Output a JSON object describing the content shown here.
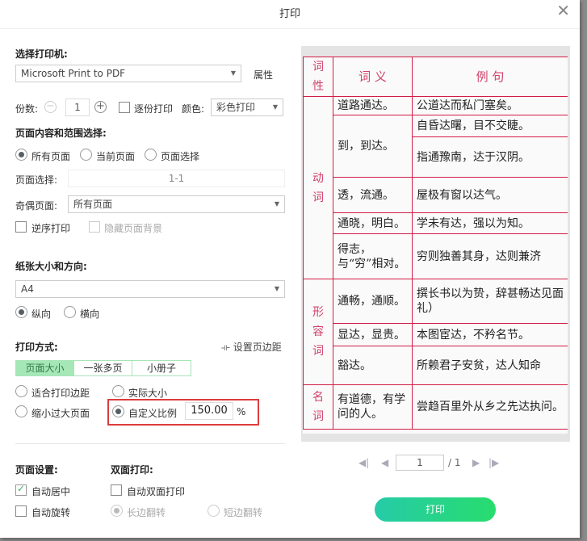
{
  "title": "打印",
  "printer": {
    "label": "选择打印机:",
    "value": "Microsoft Print to PDF",
    "properties": "属性"
  },
  "copies": {
    "label": "份数:",
    "value": "1",
    "collate": "逐份打印",
    "color_label": "颜色:",
    "color_value": "彩色打印"
  },
  "range": {
    "label": "页面内容和范围选择:",
    "all": "所有页面",
    "current": "当前页面",
    "select": "页面选择",
    "select_label": "页面选择:",
    "select_value": "1-1",
    "oddeven_label": "奇偶页面:",
    "oddeven_value": "所有页面",
    "reverse": "逆序打印",
    "hide_bg": "隐藏页面背景"
  },
  "paper": {
    "label": "纸张大小和方向:",
    "size": "A4",
    "portrait": "纵向",
    "landscape": "横向"
  },
  "mode": {
    "label": "打印方式:",
    "margins": "设置页边距",
    "tabs": [
      "页面大小",
      "一张多页",
      "小册子"
    ],
    "fit": "适合打印边距",
    "actual": "实际大小",
    "shrink": "缩小过大页面",
    "custom": "自定义比例",
    "scale": "150.00",
    "percent": "%"
  },
  "page_setup": {
    "label": "页面设置:",
    "center": "自动居中",
    "rotate": "自动旋转"
  },
  "duplex": {
    "label": "双面打印:",
    "auto": "自动双面打印",
    "long": "长边翻转",
    "short": "短边翻转"
  },
  "pager": {
    "current": "1",
    "total": "/ 1"
  },
  "print_button": "打印",
  "preview": {
    "header": [
      "词性",
      "词 义",
      "例 句"
    ],
    "pos": [
      "动词",
      "形容词",
      "名词"
    ],
    "rows": [
      {
        "meaning": "道路通达。",
        "examples": [
          "公道达而私门塞矣。"
        ]
      },
      {
        "meaning": "到，到达。",
        "examples": [
          "自昏达曙，目不交睫。",
          "指通豫南，达于汉阴。"
        ]
      },
      {
        "meaning": "透，流通。",
        "examples": [
          "屋极有窗以达气。"
        ]
      },
      {
        "meaning": "通晓，明白。",
        "examples": [
          "学未有达，强以为知。"
        ]
      },
      {
        "meaning": "得志，与“穷”相对。",
        "examples": [
          "穷则独善其身，达则兼济"
        ]
      },
      {
        "meaning": "通畅，通顺。",
        "examples": [
          "撰长书以为贽，辞甚畅达见面礼）"
        ]
      },
      {
        "meaning": "显达，显贵。",
        "examples": [
          "本图宦达，不矜名节。"
        ]
      },
      {
        "meaning": "豁达。",
        "examples": [
          "所赖君子安贫，达人知命"
        ]
      },
      {
        "meaning": "有道德，有学问的人。",
        "examples": [
          "尝趋百里外从乡之先达执问。"
        ]
      }
    ]
  }
}
